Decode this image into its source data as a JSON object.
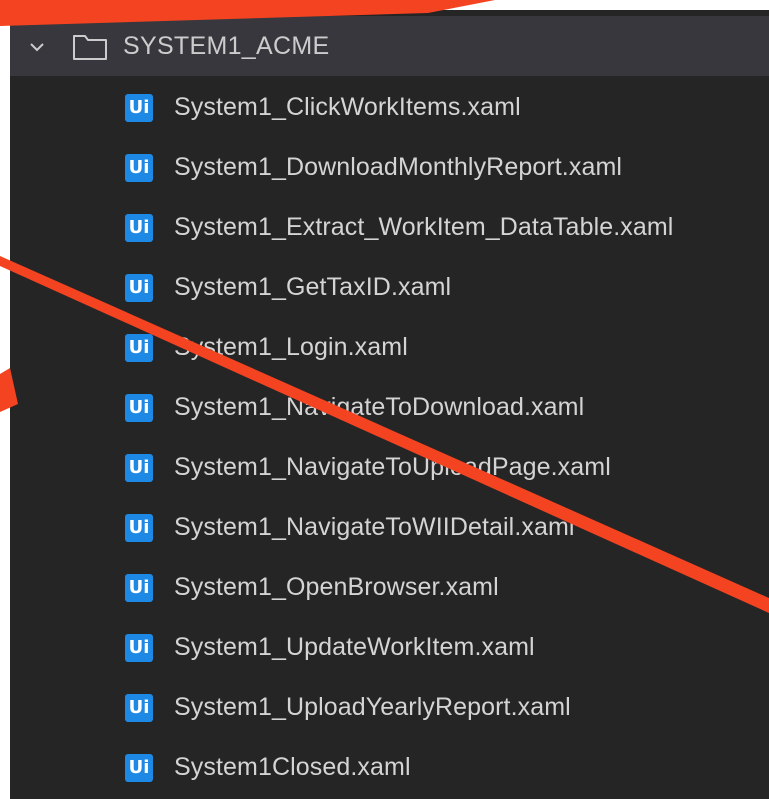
{
  "explorer": {
    "folder": {
      "label": "SYSTEM1_ACME",
      "expanded": true,
      "icon": "folder-icon",
      "chevron_icon": "chevron-down-icon"
    },
    "file_icon": {
      "text": "Ui",
      "name": "uipath-file-icon",
      "color": "#1e88e5"
    },
    "files": [
      {
        "label": "System1_ClickWorkItems.xaml"
      },
      {
        "label": "System1_DownloadMonthlyReport.xaml"
      },
      {
        "label": "System1_Extract_WorkItem_DataTable.xaml"
      },
      {
        "label": "System1_GetTaxID.xaml"
      },
      {
        "label": "System1_Login.xaml"
      },
      {
        "label": "System1_NavigateToDownload.xaml"
      },
      {
        "label": "System1_NavigateToUploadPage.xaml"
      },
      {
        "label": "System1_NavigateToWIIDetail.xaml"
      },
      {
        "label": "System1_OpenBrowser.xaml"
      },
      {
        "label": "System1_UpdateWorkItem.xaml"
      },
      {
        "label": "System1_UploadYearlyReport.xaml"
      },
      {
        "label": "System1Closed.xaml"
      }
    ]
  },
  "colors": {
    "panel_background": "#252526",
    "folder_row_background": "#37373d",
    "text": "#d4d4d4",
    "annotation": "#f44321"
  }
}
